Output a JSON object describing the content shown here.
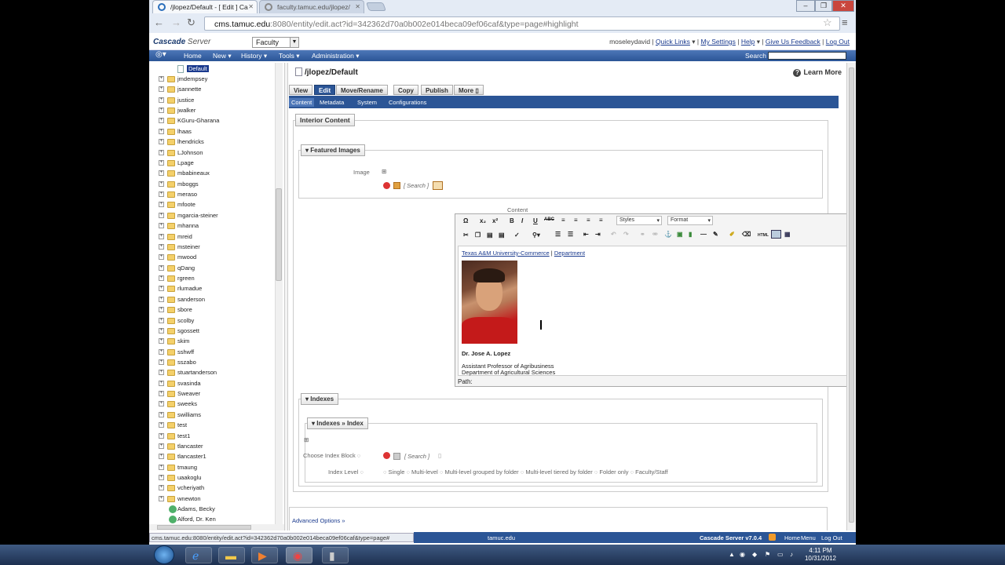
{
  "browser": {
    "tabs": [
      {
        "label": "/jlopez/Default - [ Edit ] Ca"
      },
      {
        "label": "faculty.tamuc.edu/jlopez/"
      }
    ],
    "url_host": "cms.tamuc.edu",
    "url_rest": ":8080/entity/edit.act?id=342362d70a0b002e014beca09ef06caf&type=page#highlight",
    "status_url": "cms.tamuc.edu:8080/entity/edit.act?id=342362d70a0b002e014beca09ef06caf&type=page#"
  },
  "cms_header": {
    "logo_a": "Cascade",
    "logo_b": "Server",
    "site": "Faculty",
    "user": "moseleydavid",
    "links": [
      "Quick Links",
      "My Settings",
      "Help",
      "Give Us Feedback",
      "Log Out"
    ]
  },
  "menu": {
    "items": [
      "Home",
      "New",
      "History",
      "Tools",
      "Administration"
    ],
    "search_label": "Search"
  },
  "tree": {
    "selected": "Default",
    "folders": [
      "jmdempsey",
      "jsannette",
      "justice",
      "jwalker",
      "KGuru-Gharana",
      "lhaas",
      "lhendricks",
      "LJohnson",
      "Lpage",
      "mbabineaux",
      "mboggs",
      "meraso",
      "mfoote",
      "mgarcia-steiner",
      "mhanna",
      "mreid",
      "msteiner",
      "mwood",
      "qDang",
      "rgreen",
      "rlumadue",
      "sanderson",
      "sbore",
      "scolby",
      "sgossett",
      "skim",
      "sshwff",
      "sszabo",
      "stuartanderson",
      "svasinda",
      "Sweaver",
      "sweeks",
      "swilliams",
      "test",
      "test1",
      "tlancaster",
      "tlancaster1",
      "tmaung",
      "uaakoglu",
      "vcheriyath",
      "wnewton"
    ],
    "users": [
      "Adams, Becky",
      "Alford, Dr. Ken"
    ]
  },
  "page": {
    "path": "/jlopez/Default",
    "learn_more": "Learn More",
    "action_tabs": [
      "View",
      "Edit",
      "Move/Rename",
      "Copy",
      "Publish",
      "More"
    ],
    "sub_tabs": [
      "Content",
      "Metadata",
      "System",
      "Configurations"
    ],
    "interior_legend": "Interior Content",
    "featured_legend": "Featured Images",
    "image_label": "Image",
    "search_placeholder": "[ Search ]",
    "content_label": "Content",
    "styles_label": "Styles",
    "format_label": "Format",
    "path_label": "Path:",
    "indexes_legend": "Indexes",
    "indexes_index_legend": "Indexes » Index",
    "choose_index_label": "Choose Index Block",
    "index_level_label": "Index Level",
    "index_levels": [
      "Single",
      "Multi-level",
      "Multi-level grouped by folder",
      "Multi-level tiered by folder",
      "Folder only",
      "Faculty/Staff"
    ],
    "advanced_options": "Advanced Options »"
  },
  "editor_content": {
    "link1": "Texas A&M University-Commerce",
    "sep": "|",
    "link2": "Department",
    "name": "Dr. Jose A. Lopez",
    "title1": "Assistant Professor of Agribusiness",
    "title2": "Department of Agricultural Sciences"
  },
  "footer": {
    "center": "tamuc.edu",
    "product": "Cascade Server v7.0.4",
    "links": [
      "Home",
      "Menu",
      "Log Out"
    ]
  },
  "taskbar": {
    "time": "4:11 PM",
    "date": "10/31/2012"
  }
}
